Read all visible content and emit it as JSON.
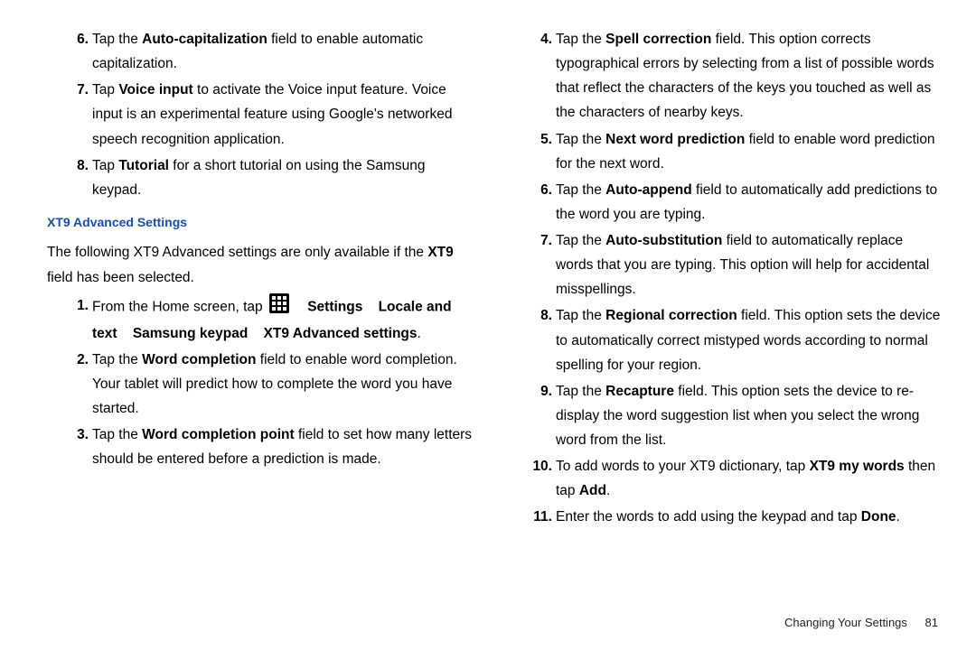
{
  "left": {
    "top_items": [
      {
        "n": "6.",
        "parts": [
          [
            "Tap the ",
            0
          ],
          [
            "Auto-capitalization",
            1
          ],
          [
            " field to enable automatic capitalization.",
            0
          ]
        ]
      },
      {
        "n": "7.",
        "parts": [
          [
            "Tap ",
            0
          ],
          [
            "Voice input",
            1
          ],
          [
            " to activate the Voice input feature. Voice input is an experimental feature using Google's networked speech recognition application.",
            0
          ]
        ]
      },
      {
        "n": "8.",
        "parts": [
          [
            "Tap ",
            0
          ],
          [
            "Tutorial",
            1
          ],
          [
            " for a short tutorial on using the Samsung keypad.",
            0
          ]
        ]
      }
    ],
    "heading": "XT9 Advanced Settings",
    "intro_parts": [
      [
        "The following XT9 Advanced settings are only available if the ",
        0
      ],
      [
        "XT9",
        1
      ],
      [
        " field has been selected.",
        0
      ]
    ],
    "items": [
      {
        "n": "1.",
        "special": "step1"
      },
      {
        "n": "2.",
        "parts": [
          [
            "Tap the ",
            0
          ],
          [
            "Word completion",
            1
          ],
          [
            " field to enable word completion. Your tablet will predict how to complete the word you have started.",
            0
          ]
        ]
      },
      {
        "n": "3.",
        "parts": [
          [
            "Tap the ",
            0
          ],
          [
            "Word completion point",
            1
          ],
          [
            " field to set how many letters should be entered before a prediction is made.",
            0
          ]
        ]
      }
    ],
    "step1": {
      "pre": "From the Home screen, tap",
      "path": [
        "Settings",
        "Locale and text",
        "Samsung keypad",
        "XT9 Advanced settings"
      ]
    }
  },
  "right": {
    "items": [
      {
        "n": "4.",
        "parts": [
          [
            "Tap the ",
            0
          ],
          [
            "Spell correction",
            1
          ],
          [
            " field. This option corrects typographical errors by selecting from a list of possible words that reflect the characters of the keys you touched as well as the characters of nearby keys.",
            0
          ]
        ]
      },
      {
        "n": "5.",
        "parts": [
          [
            "Tap the ",
            0
          ],
          [
            "Next word prediction",
            1
          ],
          [
            " field to enable word prediction for the next word.",
            0
          ]
        ]
      },
      {
        "n": "6.",
        "parts": [
          [
            "Tap the ",
            0
          ],
          [
            "Auto-append",
            1
          ],
          [
            " field to automatically add predictions to the word you are typing.",
            0
          ]
        ]
      },
      {
        "n": "7.",
        "parts": [
          [
            "Tap the ",
            0
          ],
          [
            "Auto-substitution",
            1
          ],
          [
            " field to automatically replace words that you are typing. This option will help for accidental misspellings.",
            0
          ]
        ]
      },
      {
        "n": "8.",
        "parts": [
          [
            "Tap the ",
            0
          ],
          [
            "Regional correction",
            1
          ],
          [
            " field. This option sets the device to automatically correct mistyped words according to normal spelling for your region.",
            0
          ]
        ]
      },
      {
        "n": "9.",
        "parts": [
          [
            "Tap the ",
            0
          ],
          [
            "Recapture",
            1
          ],
          [
            " field. This option sets the device to re-display the word suggestion list when you select the wrong word from the list.",
            0
          ]
        ]
      },
      {
        "n": "10.",
        "parts": [
          [
            "To add words to your XT9 dictionary, tap ",
            0
          ],
          [
            "XT9 my words",
            1
          ],
          [
            " then tap ",
            0
          ],
          [
            "Add",
            1
          ],
          [
            ".",
            0
          ]
        ]
      },
      {
        "n": "11.",
        "parts": [
          [
            "Enter the words to add using the keypad and tap ",
            0
          ],
          [
            "Done",
            1
          ],
          [
            ".",
            0
          ]
        ]
      }
    ]
  },
  "footer": {
    "section": "Changing Your Settings",
    "page": "81"
  }
}
